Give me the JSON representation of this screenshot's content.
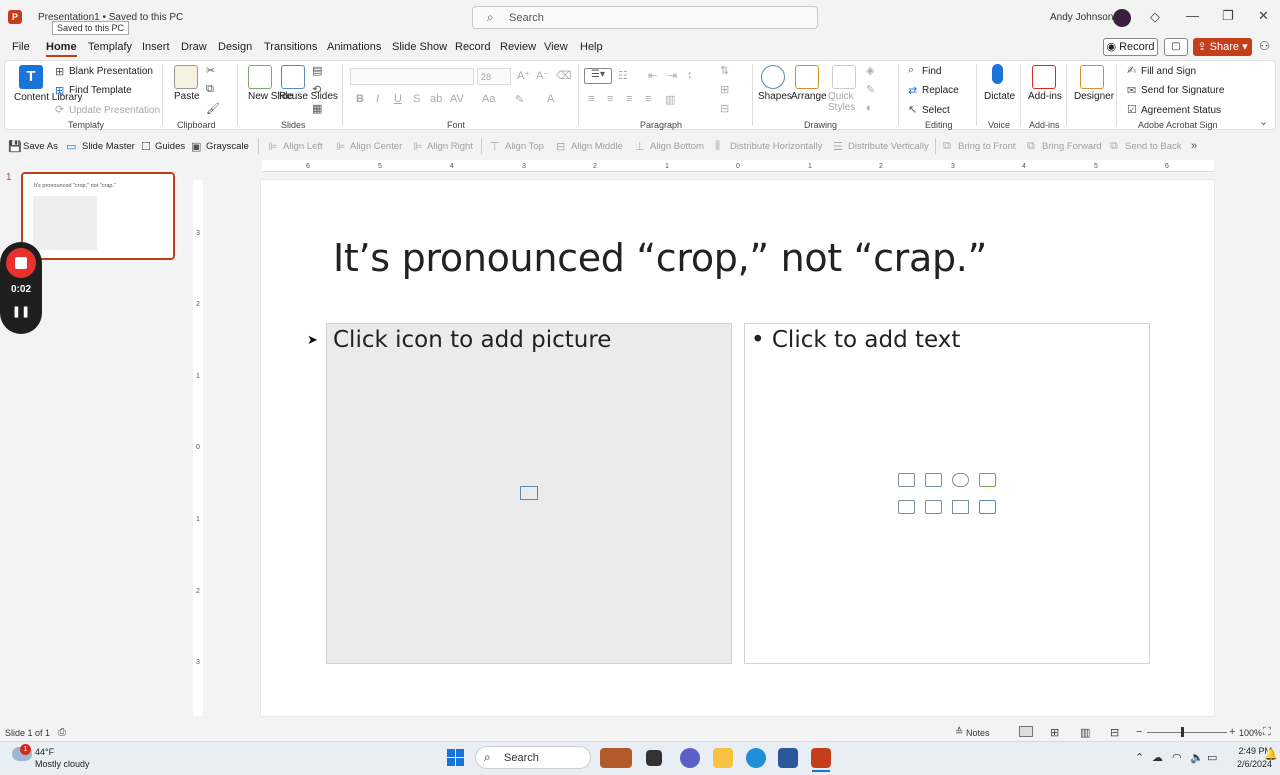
{
  "window": {
    "doc_title": "Presentation1 • Saved to this PC",
    "tooltip": "Saved to this PC",
    "search_label": "Search",
    "user_name": "Andy Johnson"
  },
  "menu": {
    "tabs": [
      "File",
      "Home",
      "Templafy",
      "Insert",
      "Draw",
      "Design",
      "Transitions",
      "Animations",
      "Slide Show",
      "Record",
      "Review",
      "View",
      "Help"
    ],
    "record_label": "Record",
    "share_label": "Share"
  },
  "ribbon": {
    "templafy": {
      "content_library": "Content Library",
      "blank_presentation": "Blank Presentation",
      "find_template": "Find Template",
      "update_presentation": "Update Presentation",
      "group": "Templafy"
    },
    "clipboard": {
      "paste": "Paste",
      "group": "Clipboard"
    },
    "slides": {
      "new_slide": "New Slide",
      "reuse_slides": "Reuse Slides",
      "group": "Slides"
    },
    "font": {
      "size": "28",
      "group": "Font"
    },
    "paragraph": {
      "group": "Paragraph"
    },
    "drawing": {
      "shapes": "Shapes",
      "arrange": "Arrange",
      "quick_styles": "Quick Styles",
      "group": "Drawing"
    },
    "editing": {
      "find": "Find",
      "replace": "Replace",
      "select": "Select",
      "group": "Editing"
    },
    "voice": {
      "dictate": "Dictate",
      "group": "Voice"
    },
    "addins": {
      "addins": "Add-ins",
      "group": "Add-ins"
    },
    "designer": {
      "designer": "Designer"
    },
    "acrobat": {
      "fill_sign": "Fill and Sign",
      "send_signature": "Send for Signature",
      "agreement_status": "Agreement Status",
      "group": "Adobe Acrobat Sign"
    }
  },
  "align_toolbar": {
    "save_as": "Save As",
    "slide_master": "Slide Master",
    "guides": "Guides",
    "grayscale": "Grayscale",
    "align_left": "Align Left",
    "align_center": "Align Center",
    "align_right": "Align Right",
    "align_top": "Align Top",
    "align_middle": "Align Middle",
    "align_bottom": "Align Bottom",
    "distribute_h": "Distribute Horizontally",
    "distribute_v": "Distribute Vertically",
    "bring_front": "Bring to Front",
    "bring_forward": "Bring Forward",
    "send_back": "Send to Back"
  },
  "ruler": {
    "h_ticks": [
      "6",
      "5",
      "4",
      "3",
      "2",
      "1",
      "0",
      "1",
      "2",
      "3",
      "4",
      "5",
      "6"
    ],
    "v_ticks": [
      "3",
      "2",
      "1",
      "0",
      "1",
      "2",
      "3"
    ]
  },
  "slide_panel": {
    "slide_number": "1",
    "thumb_title": "It's pronounced \"crop,\" not \"crap.\""
  },
  "recorder": {
    "time": "0:02"
  },
  "slide": {
    "title": "It’s pronounced “crop,” not “crap.”",
    "picture_placeholder": "Click icon to add picture",
    "text_placeholder": "• Click to add text"
  },
  "status": {
    "slide_info": "Slide 1 of 1",
    "notes": "Notes",
    "zoom": "100%"
  },
  "taskbar": {
    "weather_temp": "44°F",
    "weather_desc": "Mostly cloudy",
    "weather_badge": "1",
    "search_label": "Search",
    "time": "2:49 PM",
    "date": "2/6/2024"
  }
}
